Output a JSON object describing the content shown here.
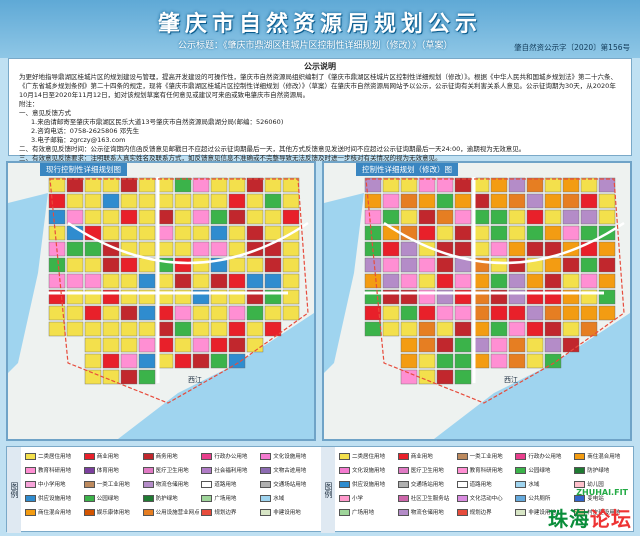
{
  "header": {
    "title": "肇庆市自然资源局规划公示",
    "subtitle": "公示标题：《肇庆市鼎湖区桂城片区控制性详细规划（修改）》（草案）",
    "doc_number": "肇自然资公示字〔2020〕第156号"
  },
  "notice": {
    "heading": "公示说明",
    "para1": "为更好地指导鼎湖区桂城片区的规划建设与管理，提高开发建设的可操作性，肇庆市自然资源局组织编制了《肇庆市鼎湖区桂城片区控制性详细规划（修改）》。根据《中华人民共和国城乡规划法》第二十六条、《广东省城乡规划条例》第二十四条的规定，现将《肇庆市鼎湖区桂城片区控制性详细规划（修改）》（草案）在肇庆市自然资源局网站予以公示，公示征询有关利害关系人意见。公示征询期为30天，从2020年10月14日至2020年11月12日，如对该规划草案有任何意见或建议可来函或致电肇庆市自然资源局。",
    "attach": "附注：",
    "item1": "一、意见反馈方式",
    "item1a": "1.来函请邮寄至肇庆市鼎湖区民乐大道13号肇庆市自然资源局鼎湖分局(邮编：526060)",
    "item1b": "2.咨询电话：0758-2625806  邓先生",
    "item1c": "3.电子邮箱：zgrczy@163.com",
    "item2": "二、有效意见反馈时间：公示征询期内信函反馈意见邮戳日不应超过公示征询期最后一天，其他方式反馈意见发送时间不应超过公示征询期最后一天24:00，逾期视为无效意见。",
    "item3": "三、有效意见反馈要求：注明联系人真实姓名及联系方式，如反馈意见信息不准确或不完整导致无法反馈及时进一步核对有关情况的视为无效意见。"
  },
  "panels": [
    {
      "tag": "现行控制性详细规划图",
      "river_label": "西江"
    },
    {
      "tag": "控制性详细规划（修改）图",
      "river_label": "西江"
    }
  ],
  "legend": {
    "heading": "图例",
    "items": [
      {
        "label": "二类居住用地",
        "color": "#f3e04c"
      },
      {
        "label": "商业用地",
        "color": "#e8202a"
      },
      {
        "label": "商务用地",
        "color": "#c1272d"
      },
      {
        "label": "行政办公用地",
        "color": "#e83e8c"
      },
      {
        "label": "文化设施用地",
        "color": "#f47bd0"
      },
      {
        "label": "教育科研用地",
        "color": "#ff8fd3"
      },
      {
        "label": "体育用地",
        "color": "#7b3f9e"
      },
      {
        "label": "医疗卫生用地",
        "color": "#e07ac4"
      },
      {
        "label": "社会福利用地",
        "color": "#b07cc6"
      },
      {
        "label": "文物古迹用地",
        "color": "#8c6bb1"
      },
      {
        "label": "中小学用地",
        "color": "#f6a3d9"
      },
      {
        "label": "一类工业用地",
        "color": "#bd8a5e"
      },
      {
        "label": "物流仓储用地",
        "color": "#b48cc8"
      },
      {
        "label": "道路用地",
        "color": "#ffffff"
      },
      {
        "label": "交通场站用地",
        "color": "#b0b0b0"
      },
      {
        "label": "供应设施用地",
        "color": "#2f8ccf"
      },
      {
        "label": "公园绿地",
        "color": "#3bb34a"
      },
      {
        "label": "防护绿地",
        "color": "#1f7a32"
      },
      {
        "label": "广场用地",
        "color": "#9fd59a"
      },
      {
        "label": "水域",
        "color": "#9fd4ef"
      },
      {
        "label": "商住混合用地",
        "color": "#f39c12"
      },
      {
        "label": "娱乐康体用地",
        "color": "#d35400"
      },
      {
        "label": "公用设施营业网点",
        "color": "#e67e22"
      },
      {
        "label": "规划边界",
        "color": "#e74c3c"
      },
      {
        "label": "非建设用地",
        "color": "#d8e6c6"
      }
    ],
    "items_right": [
      {
        "label": "二类居住用地",
        "color": "#f3e04c"
      },
      {
        "label": "商业用地",
        "color": "#e8202a"
      },
      {
        "label": "一类工业用地",
        "color": "#bd8a5e"
      },
      {
        "label": "行政办公用地",
        "color": "#e83e8c"
      },
      {
        "label": "商住混合用地",
        "color": "#f39c12"
      },
      {
        "label": "文化设施用地",
        "color": "#f47bd0"
      },
      {
        "label": "医疗卫生用地",
        "color": "#e07ac4"
      },
      {
        "label": "教育科研用地",
        "color": "#ff8fd3"
      },
      {
        "label": "公园绿地",
        "color": "#3bb34a"
      },
      {
        "label": "防护绿地",
        "color": "#1f7a32"
      },
      {
        "label": "供应设施用地",
        "color": "#2f8ccf"
      },
      {
        "label": "交通场站用地",
        "color": "#b0b0b0"
      },
      {
        "label": "道路用地",
        "color": "#ffffff"
      },
      {
        "label": "水域",
        "color": "#9fd4ef"
      },
      {
        "label": "幼儿园",
        "color": "#ffc0cb"
      },
      {
        "label": "小学",
        "color": "#ff99cc"
      },
      {
        "label": "社区卫生服务站",
        "color": "#cc66aa"
      },
      {
        "label": "文化活动中心",
        "color": "#d98ce0"
      },
      {
        "label": "公共厕所",
        "color": "#66aadd"
      },
      {
        "label": "变电站",
        "color": "#3366cc"
      },
      {
        "label": "广场用地",
        "color": "#9fd59a"
      },
      {
        "label": "物流仓储用地",
        "color": "#b48cc8"
      },
      {
        "label": "规划边界",
        "color": "#e74c3c"
      },
      {
        "label": "非建设用地",
        "color": "#d8e6c6"
      },
      {
        "label": "村庄建设用地",
        "color": "#f7c8a0"
      }
    ]
  },
  "watermark": {
    "domain": "ZHUHAI.FIT",
    "text_green": "珠海",
    "text_red": "论坛"
  }
}
